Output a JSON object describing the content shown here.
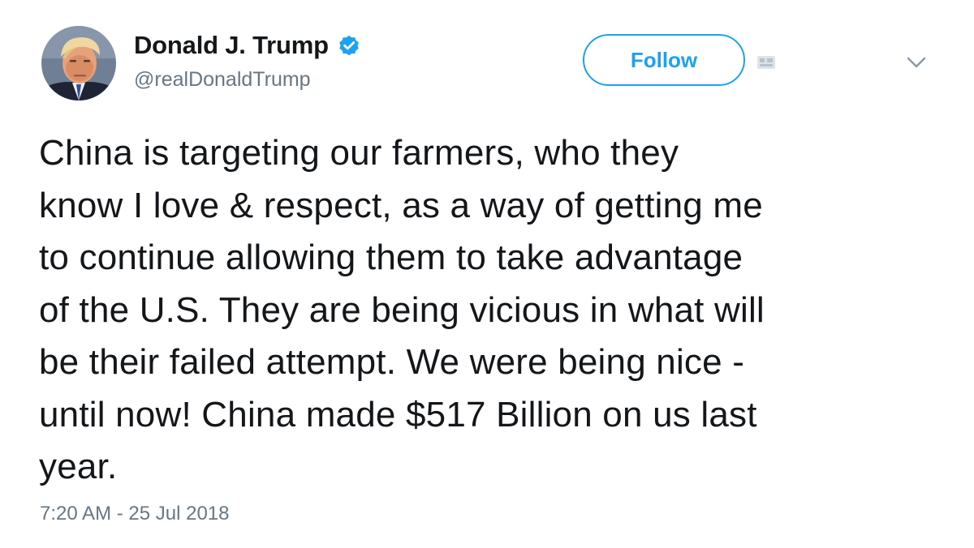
{
  "tweet": {
    "author": {
      "display_name": "Donald J. Trump",
      "handle": "@realDonaldTrump",
      "verified": true
    },
    "follow_label": "Follow",
    "text": "China is targeting our farmers, who they\nknow I love & respect, as a way of getting me\nto continue allowing them to take advantage\nof the U.S. They are being vicious in what will\nbe their failed attempt. We were being nice -\nuntil now! China made $517 Billion on us last\nyear.",
    "timestamp": "7:20 AM - 25 Jul 2018"
  },
  "icons": {
    "verified": "verified-badge-icon",
    "follow_extra": "follow-notification-icon",
    "menu": "chevron-down-icon"
  },
  "colors": {
    "accent": "#1da1f2",
    "text": "#14171a",
    "secondary": "#657786"
  }
}
